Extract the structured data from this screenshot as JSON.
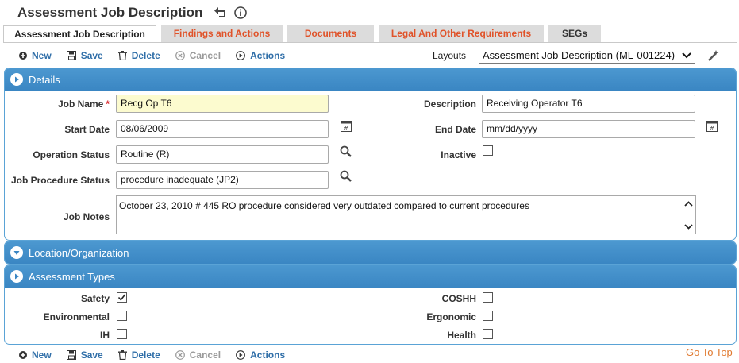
{
  "header": {
    "title": "Assessment Job Description",
    "back_icon": "undo-arrow-icon",
    "info_icon": "info-icon"
  },
  "tabs": [
    {
      "label": "Assessment Job Description",
      "active": true
    },
    {
      "label": "Findings and Actions",
      "active": false
    },
    {
      "label": "Documents",
      "active": false
    },
    {
      "label": "Legal And Other Requirements",
      "active": false
    },
    {
      "label": "SEGs",
      "active": false
    }
  ],
  "toolbar": {
    "new_label": "New",
    "save_label": "Save",
    "delete_label": "Delete",
    "cancel_label": "Cancel",
    "actions_label": "Actions"
  },
  "layouts": {
    "label": "Layouts",
    "selected": "Assessment Job Description (ML-001224)"
  },
  "details": {
    "header": "Details",
    "job_name_label": "Job Name",
    "job_name_required": "*",
    "job_name": "Recg Op T6",
    "description_label": "Description",
    "description": "Receiving Operator T6",
    "start_date_label": "Start Date",
    "start_date": "08/06/2009",
    "end_date_label": "End Date",
    "end_date_placeholder": "mm/dd/yyyy",
    "operation_status_label": "Operation Status",
    "operation_status": "Routine (R)",
    "inactive_label": "Inactive",
    "inactive_checked": false,
    "job_procedure_status_label": "Job Procedure Status",
    "job_procedure_status": "procedure inadequate (JP2)",
    "job_notes_label": "Job Notes",
    "job_notes": "October 23, 2010 # 445 RO procedure considered very outdated compared to current procedures"
  },
  "location_section": {
    "header": "Location/Organization"
  },
  "assessment_types": {
    "header": "Assessment Types",
    "safety_label": "Safety",
    "safety_checked": true,
    "environmental_label": "Environmental",
    "environmental_checked": false,
    "ih_label": "IH",
    "ih_checked": false,
    "coshh_label": "COSHH",
    "coshh_checked": false,
    "ergonomic_label": "Ergonomic",
    "ergonomic_checked": false,
    "health_label": "Health",
    "health_checked": false
  },
  "footer": {
    "go_to_top": "Go To Top"
  },
  "colors": {
    "accent": "#3a86c3",
    "tab_inactive_text": "#e0532a",
    "link": "#2f6ea8",
    "required": "#d9262c",
    "go_to_top": "#e0792f",
    "yellow_field": "#fcfbcf"
  }
}
